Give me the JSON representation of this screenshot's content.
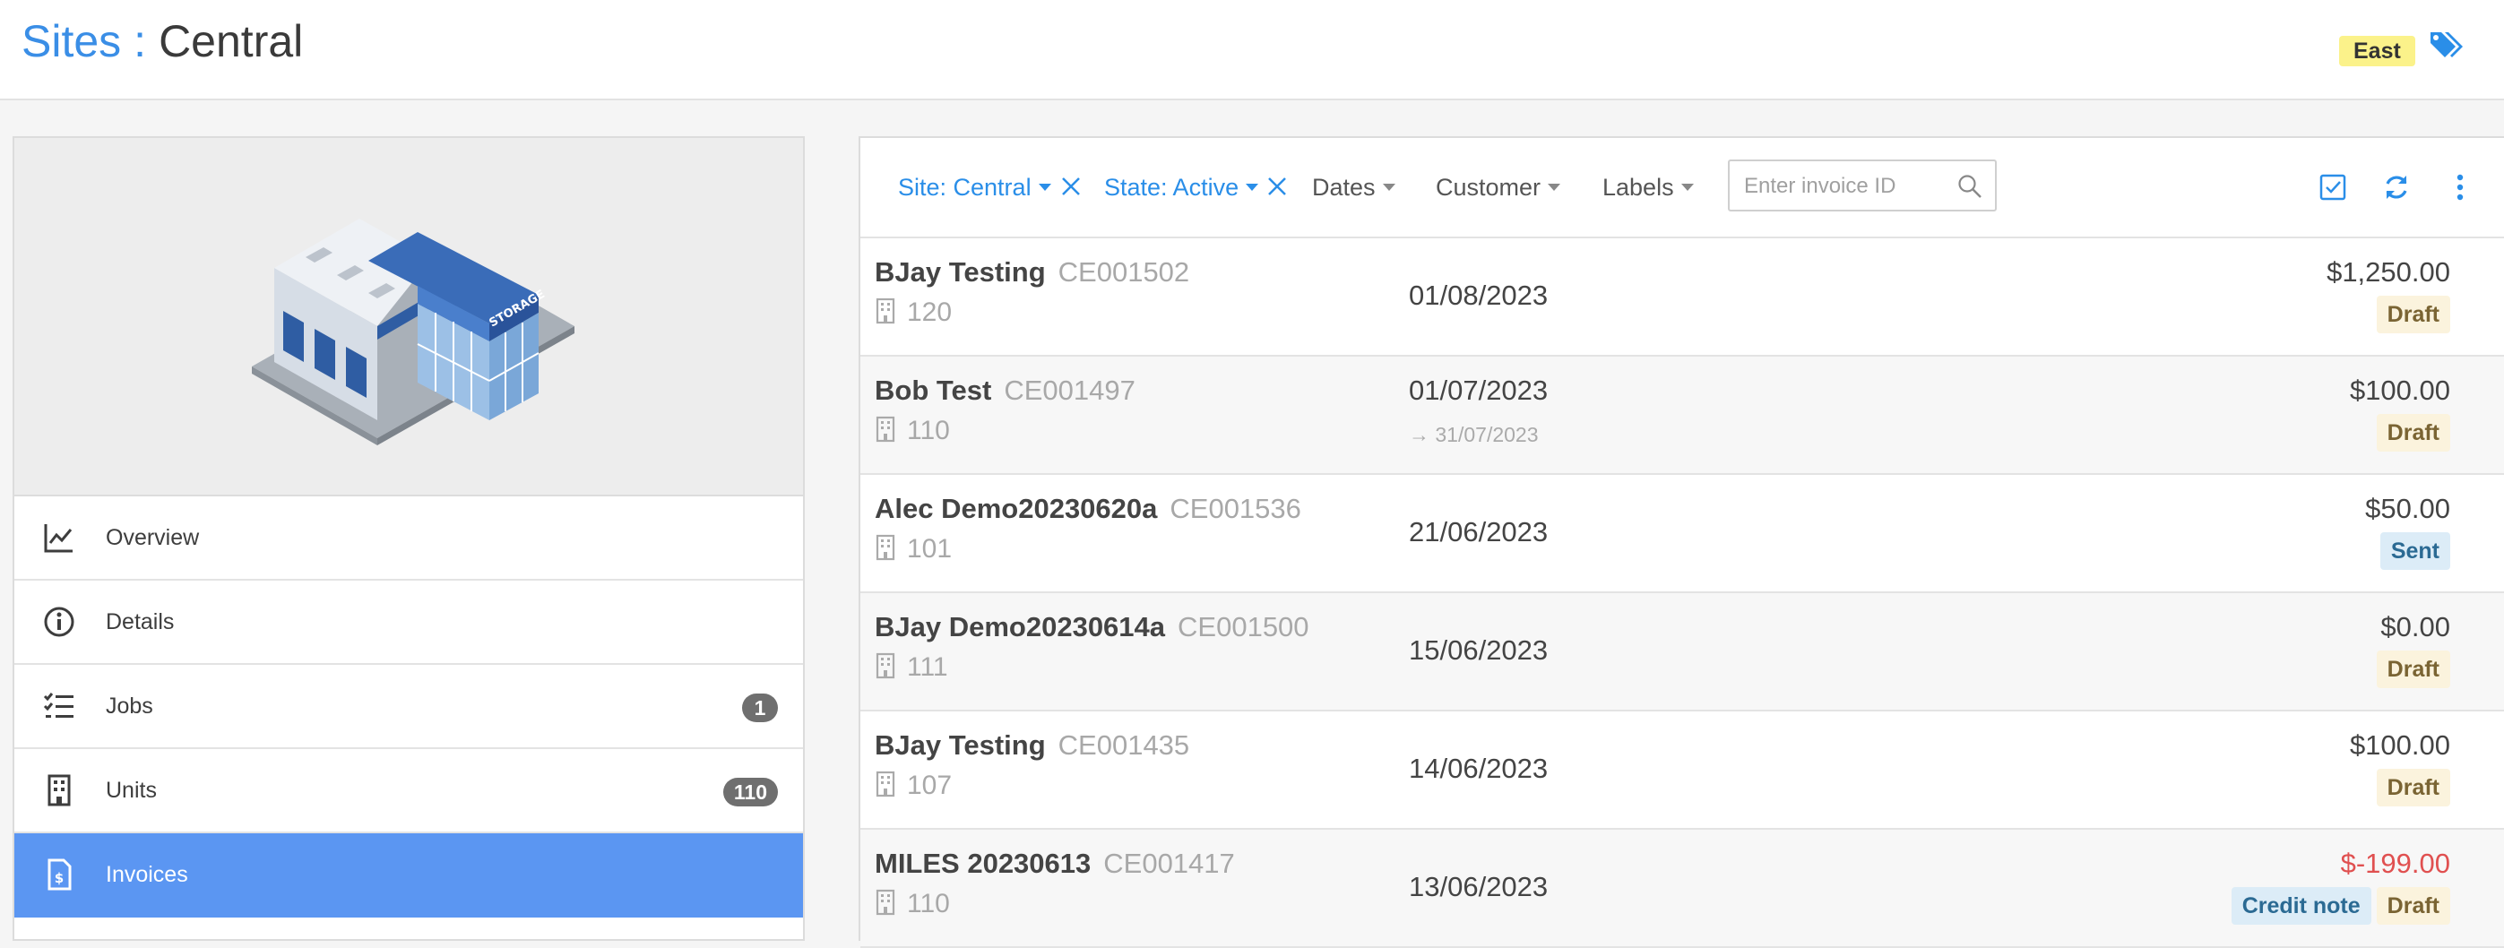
{
  "header": {
    "crumb": "Sites",
    "separator": ":",
    "current": "Central",
    "region_badge": "East",
    "tags_icon": "tags-icon",
    "accent_color": "#3a8ee6"
  },
  "sidebar": {
    "image": "storage-building-illustration",
    "items": [
      {
        "label": "Overview",
        "icon": "chart-line-icon",
        "count": null,
        "active": false
      },
      {
        "label": "Details",
        "icon": "info-circle-icon",
        "count": null,
        "active": false
      },
      {
        "label": "Jobs",
        "icon": "checklist-icon",
        "count": "1",
        "active": false
      },
      {
        "label": "Units",
        "icon": "building-icon",
        "count": "110",
        "active": false
      },
      {
        "label": "Invoices",
        "icon": "invoice-icon",
        "count": null,
        "active": true
      }
    ],
    "active_color": "#5b96f2"
  },
  "filters": {
    "site": "Site: Central",
    "state": "State: Active",
    "dates": "Dates",
    "customer": "Customer",
    "labels": "Labels",
    "search_placeholder": "Enter invoice ID"
  },
  "toolbar": {
    "select_icon": "checkbox-icon",
    "refresh_icon": "refresh-icon",
    "more_icon": "more-vertical-icon"
  },
  "invoices": [
    {
      "name": "BJay Testing",
      "id": "CE001502",
      "unit": "120",
      "date": "01/08/2023",
      "due": "",
      "amount": "$1,250.00",
      "negative": false,
      "badges": [
        {
          "label": "Draft",
          "kind": "draft"
        }
      ]
    },
    {
      "name": "Bob Test",
      "id": "CE001497",
      "unit": "110",
      "date": "01/07/2023",
      "due": "→ 31/07/2023",
      "amount": "$100.00",
      "negative": false,
      "badges": [
        {
          "label": "Draft",
          "kind": "draft"
        }
      ]
    },
    {
      "name": "Alec Demo20230620a",
      "id": "CE001536",
      "unit": "101",
      "date": "21/06/2023",
      "due": "",
      "amount": "$50.00",
      "negative": false,
      "badges": [
        {
          "label": "Sent",
          "kind": "sent"
        }
      ]
    },
    {
      "name": "BJay Demo20230614a",
      "id": "CE001500",
      "unit": "111",
      "date": "15/06/2023",
      "due": "",
      "amount": "$0.00",
      "negative": false,
      "badges": [
        {
          "label": "Draft",
          "kind": "draft"
        }
      ]
    },
    {
      "name": "BJay Testing",
      "id": "CE001435",
      "unit": "107",
      "date": "14/06/2023",
      "due": "",
      "amount": "$100.00",
      "negative": false,
      "badges": [
        {
          "label": "Draft",
          "kind": "draft"
        }
      ]
    },
    {
      "name": "MILES 20230613",
      "id": "CE001417",
      "unit": "110",
      "date": "13/06/2023",
      "due": "",
      "amount": "$-199.00",
      "negative": true,
      "badges": [
        {
          "label": "Credit note",
          "kind": "credit"
        },
        {
          "label": "Draft",
          "kind": "draft"
        }
      ]
    }
  ]
}
